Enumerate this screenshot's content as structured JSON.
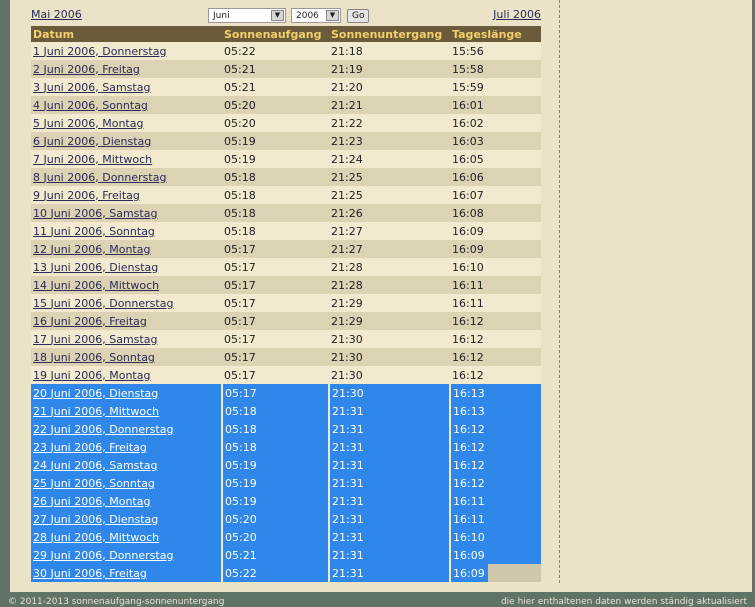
{
  "nav": {
    "prev_month": "Mai 2006",
    "next_month": "Juli 2006",
    "month_select": "Juni",
    "year_select": "2006",
    "go_label": "Go"
  },
  "table": {
    "headers": [
      "Datum",
      "Sonnenaufgang",
      "Sonnenuntergang",
      "Tageslänge"
    ],
    "rows": [
      [
        "1 Juni 2006, Donnerstag",
        "05:22",
        "21:18",
        "15:56"
      ],
      [
        "2 Juni 2006, Freitag",
        "05:21",
        "21:19",
        "15:58"
      ],
      [
        "3 Juni 2006, Samstag",
        "05:21",
        "21:20",
        "15:59"
      ],
      [
        "4 Juni 2006, Sonntag",
        "05:20",
        "21:21",
        "16:01"
      ],
      [
        "5 Juni 2006, Montag",
        "05:20",
        "21:22",
        "16:02"
      ],
      [
        "6 Juni 2006, Dienstag",
        "05:19",
        "21:23",
        "16:03"
      ],
      [
        "7 Juni 2006, Mittwoch",
        "05:19",
        "21:24",
        "16:05"
      ],
      [
        "8 Juni 2006, Donnerstag",
        "05:18",
        "21:25",
        "16:06"
      ],
      [
        "9 Juni 2006, Freitag",
        "05:18",
        "21:25",
        "16:07"
      ],
      [
        "10 Juni 2006, Samstag",
        "05:18",
        "21:26",
        "16:08"
      ],
      [
        "11 Juni 2006, Sonntag",
        "05:18",
        "21:27",
        "16:09"
      ],
      [
        "12 Juni 2006, Montag",
        "05:17",
        "21:27",
        "16:09"
      ],
      [
        "13 Juni 2006, Dienstag",
        "05:17",
        "21:28",
        "16:10"
      ],
      [
        "14 Juni 2006, Mittwoch",
        "05:17",
        "21:28",
        "16:11"
      ],
      [
        "15 Juni 2006, Donnerstag",
        "05:17",
        "21:29",
        "16:11"
      ],
      [
        "16 Juni 2006, Freitag",
        "05:17",
        "21:29",
        "16:12"
      ],
      [
        "17 Juni 2006, Samstag",
        "05:17",
        "21:30",
        "16:12"
      ],
      [
        "18 Juni 2006, Sonntag",
        "05:17",
        "21:30",
        "16:12"
      ],
      [
        "19 Juni 2006, Montag",
        "05:17",
        "21:30",
        "16:12"
      ],
      [
        "20 Juni 2006, Dienstag",
        "05:17",
        "21:30",
        "16:13"
      ],
      [
        "21 Juni 2006, Mittwoch",
        "05:18",
        "21:31",
        "16:13"
      ],
      [
        "22 Juni 2006, Donnerstag",
        "05:18",
        "21:31",
        "16:12"
      ],
      [
        "23 Juni 2006, Freitag",
        "05:18",
        "21:31",
        "16:12"
      ],
      [
        "24 Juni 2006, Samstag",
        "05:19",
        "21:31",
        "16:12"
      ],
      [
        "25 Juni 2006, Sonntag",
        "05:19",
        "21:31",
        "16:12"
      ],
      [
        "26 Juni 2006, Montag",
        "05:19",
        "21:31",
        "16:11"
      ],
      [
        "27 Juni 2006, Dienstag",
        "05:20",
        "21:31",
        "16:11"
      ],
      [
        "28 Juni 2006, Mittwoch",
        "05:20",
        "21:31",
        "16:10"
      ],
      [
        "29 Juni 2006, Donnerstag",
        "05:21",
        "21:31",
        "16:09"
      ],
      [
        "30 Juni 2006, Freitag",
        "05:22",
        "21:31",
        "16:09"
      ]
    ],
    "selected_row_indices": [
      19,
      20,
      21,
      22,
      23,
      24,
      25,
      26,
      27,
      28,
      29
    ]
  },
  "footer": {
    "left": "© 2011-2013 sonnenaufgang-sonnenuntergang",
    "right": "die hier enthaltenen daten werden ständig aktualisiert"
  },
  "colors": {
    "page_bg": "#ebe3c8",
    "outer_bg": "#5f7366",
    "header_bg": "#6a5c3b",
    "header_text": "#f4cf6a",
    "row_odd": "#f1eacf",
    "row_even": "#dcd2b4",
    "selection": "#2f87ea",
    "link": "#2b2b55"
  }
}
